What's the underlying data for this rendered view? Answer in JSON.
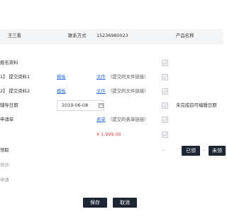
{
  "header": {
    "name_value": "王三看",
    "contact_label": "联系方式",
    "contact_value": "15236980023",
    "product_label": "产品名称"
  },
  "rows": {
    "apply_materials": "报名资料",
    "submit1_label": "1】 提交资料1",
    "submit2_label": "2】 提交资料2",
    "template_link": "模板",
    "file_link": "文件",
    "file_hint": "（提交的文件链接）",
    "coach_date_label": "辅导日期",
    "coach_date_value": "2019-06-08",
    "date_note": "未完成前可编辑日期",
    "apply_form_label": "申请单",
    "form_link": "表单",
    "form_hint": "（提交的表单链接）",
    "price": "¥ 1,999.00",
    "receive_label": "领取",
    "dash1": "--",
    "dash2": "--",
    "training_label": "培训",
    "apply_label": "申请",
    "received_button": "已领",
    "unreceived_button": "未领"
  },
  "actions": {
    "save": "保存",
    "cancel": "取消"
  },
  "colors": {
    "accent_link": "#2f6fd1",
    "price_red": "#e03a3a",
    "dark_button": "#1e2633",
    "bar_bg": "#f4f5f7"
  }
}
